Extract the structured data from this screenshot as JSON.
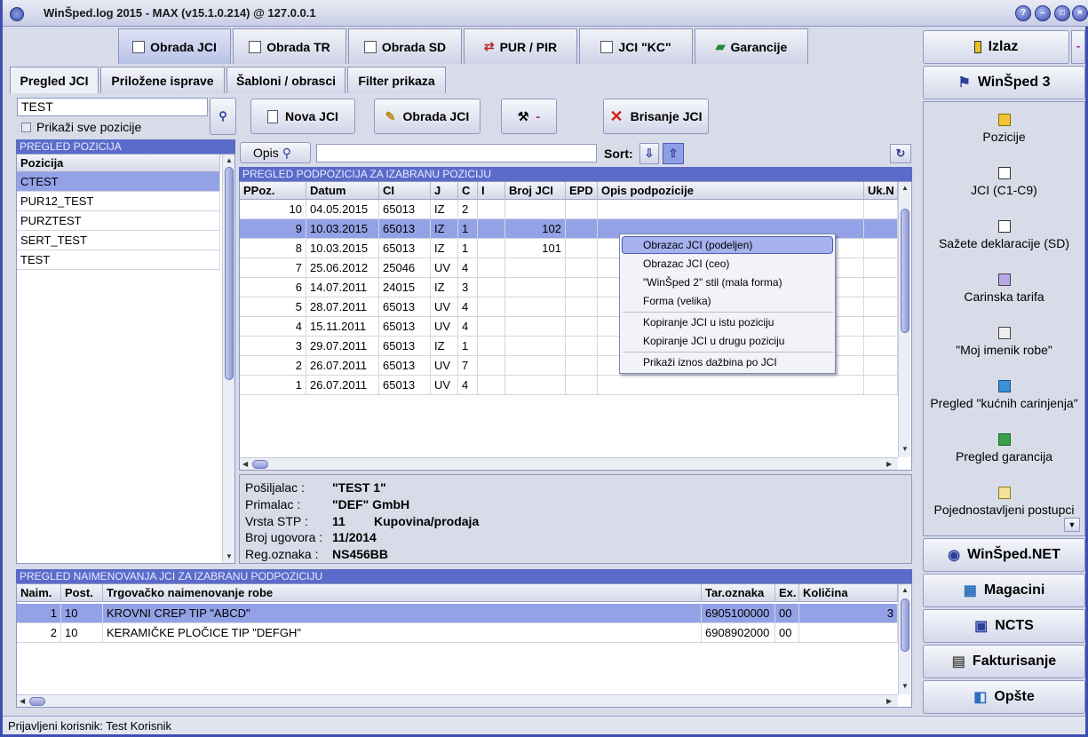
{
  "window": {
    "title": "WinŠped.log 2015 - MAX (v15.1.0.214) @ 127.0.0.1"
  },
  "main_tabs": [
    "Obrada JCI",
    "Obrada TR",
    "Obrada SD",
    "PUR / PIR",
    "JCI \"KC\"",
    "Garancije"
  ],
  "sub_tabs": [
    "Pregled JCI",
    "Priložene isprave",
    "Šabloni / obrasci",
    "Filter prikaza"
  ],
  "left": {
    "search_value": "TEST",
    "show_all_label": "Prikaži sve pozicije",
    "section_title": "PREGLED POZICIJA",
    "column": "Pozicija",
    "items": [
      "CTEST",
      "PUR12_TEST",
      "PURZTEST",
      "SERT_TEST",
      "TEST"
    ]
  },
  "toolbar": {
    "new_label": "Nova JCI",
    "process_label": "Obrada JCI",
    "tools_label": "-",
    "delete_label": "Brisanje JCI"
  },
  "filter": {
    "opis_label": "Opis",
    "sort_label": "Sort:"
  },
  "subpositions": {
    "section_title": "PREGLED PODPOZICIJA ZA IZABRANU POZICIJU",
    "columns": [
      "PPoz.",
      "Datum",
      "CI",
      "J",
      "C",
      "I",
      "Broj JCI",
      "EPD",
      "Opis podpozicije",
      "Uk.N"
    ],
    "rows": [
      [
        "10",
        "04.05.2015",
        "65013",
        "IZ",
        "2",
        "",
        "",
        "",
        "",
        ""
      ],
      [
        "9",
        "10.03.2015",
        "65013",
        "IZ",
        "1",
        "",
        "102",
        "",
        "",
        ""
      ],
      [
        "8",
        "10.03.2015",
        "65013",
        "IZ",
        "1",
        "",
        "101",
        "",
        "",
        ""
      ],
      [
        "7",
        "25.06.2012",
        "25046",
        "UV",
        "4",
        "",
        "",
        "",
        "",
        ""
      ],
      [
        "6",
        "14.07.2011",
        "24015",
        "IZ",
        "3",
        "",
        "",
        "",
        "",
        ""
      ],
      [
        "5",
        "28.07.2011",
        "65013",
        "UV",
        "4",
        "",
        "",
        "",
        "",
        ""
      ],
      [
        "4",
        "15.11.2011",
        "65013",
        "UV",
        "4",
        "",
        "",
        "",
        "",
        ""
      ],
      [
        "3",
        "29.07.2011",
        "65013",
        "IZ",
        "1",
        "",
        "",
        "",
        "",
        ""
      ],
      [
        "2",
        "26.07.2011",
        "65013",
        "UV",
        "7",
        "",
        "",
        "",
        "",
        ""
      ],
      [
        "1",
        "26.07.2011",
        "65013",
        "UV",
        "4",
        "",
        "",
        "",
        "",
        ""
      ]
    ]
  },
  "context_menu": [
    "Obrazac JCI (podeljen)",
    "Obrazac JCI (ceo)",
    "\"WinŠped 2\" stil (mala forma)",
    "Forma (velika)",
    "Kopiranje JCI u istu poziciju",
    "Kopiranje JCI u drugu poziciju",
    "Prikaži iznos dažbina po JCI"
  ],
  "details": {
    "labels": [
      "Pošiljalac :",
      "Primalac :",
      "Vrsta STP :",
      "Broj ugovora :",
      "Reg.oznaka :"
    ],
    "values": [
      "\"TEST 1\"",
      "\"DEF\" GmbH",
      "11",
      "11/2014",
      "NS456BB"
    ],
    "stp_desc": "Kupovina/prodaja"
  },
  "names": {
    "section_title": "PREGLED NAIMENOVANJA JCI ZA IZABRANU PODPOZICIJU",
    "columns": [
      "Naim.",
      "Post.",
      "Trgovačko naimenovanje robe",
      "Tar.oznaka",
      "Ex.",
      "Količina"
    ],
    "rows": [
      [
        "1",
        "10",
        "KROVNI CREP TIP \"ABCD\"",
        "6905100000",
        "00",
        "3"
      ],
      [
        "2",
        "10",
        "KERAMIČKE PLOČICE TIP \"DEFGH\"",
        "6908902000",
        "00",
        ""
      ]
    ]
  },
  "right": {
    "izlaz": "Izlaz",
    "izlaz_extra": "-",
    "winsped3": "WinŠped 3",
    "items": [
      "Pozicije",
      "JCI (C1-C9)",
      "Sažete deklaracije (SD)",
      "Carinska tarifa",
      "\"Moj imenik robe\"",
      "Pregled \"kućnih carinjenja\"",
      "Pregled garancija",
      "Pojednostavljeni postupci"
    ],
    "bottom": [
      "WinŠped.NET",
      "Magacini",
      "NCTS",
      "Fakturisanje",
      "Opšte"
    ]
  },
  "status": {
    "user": "Prijavljeni korisnik: Test Korisnik"
  },
  "colors": {
    "accent": "#5b6bc9",
    "selection": "#93a1e6",
    "frame": "#3f4fb0"
  }
}
